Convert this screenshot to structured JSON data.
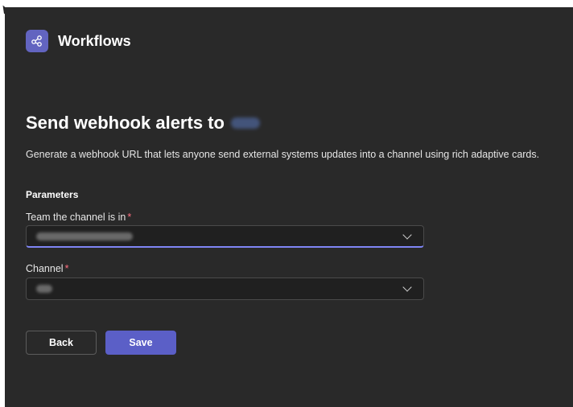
{
  "app": {
    "title": "Workflows",
    "icon": "workflow-share-icon",
    "accent": "#6264c0"
  },
  "page": {
    "title": "Send webhook alerts to",
    "description": "Generate a webhook URL that lets anyone send external systems updates into a channel using rich adaptive cards."
  },
  "parameters": {
    "section_title": "Parameters",
    "team": {
      "label": "Team the channel is in",
      "required_mark": "*"
    },
    "channel": {
      "label": "Channel",
      "required_mark": "*"
    }
  },
  "buttons": {
    "back_label": "Back",
    "save_label": "Save"
  },
  "colors": {
    "panel_bg": "#292929",
    "primary": "#5b5fc7",
    "required": "#ff6e80"
  }
}
